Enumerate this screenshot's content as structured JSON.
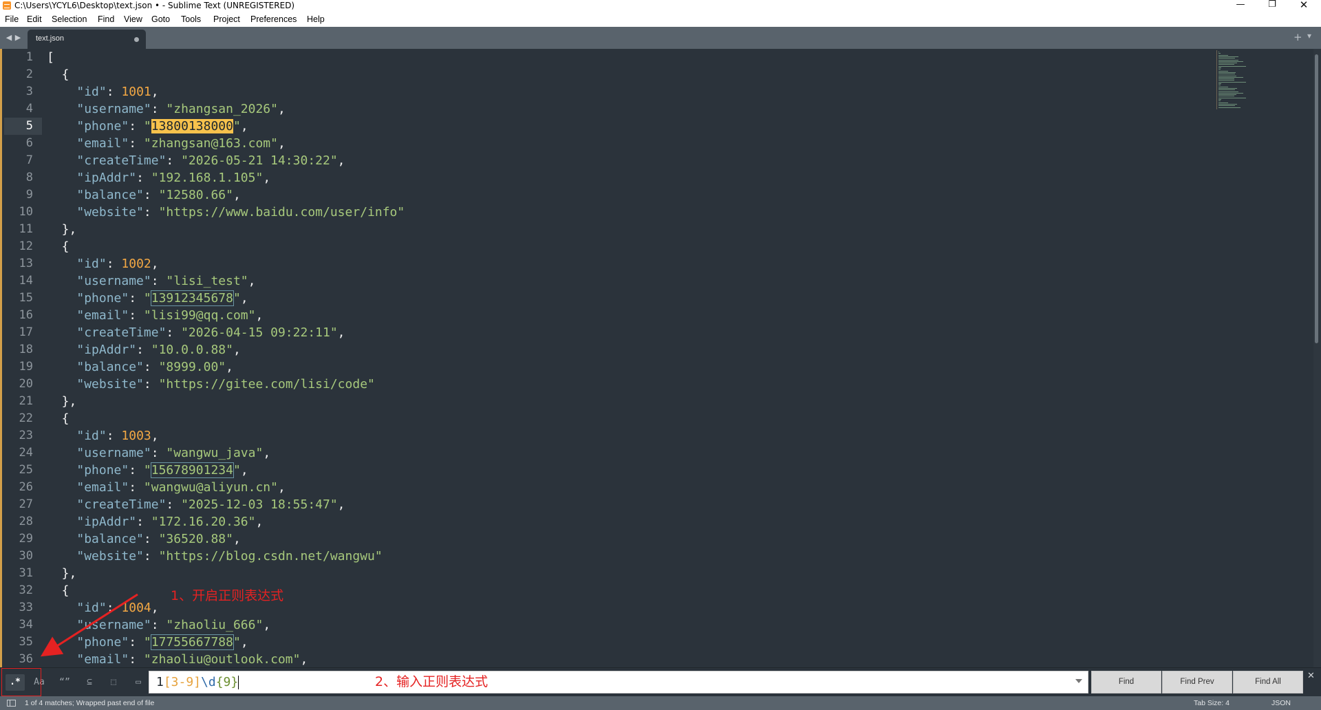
{
  "window": {
    "title": "C:\\Users\\YCYL6\\Desktop\\text.json • - Sublime Text (UNREGISTERED)",
    "minimize": "—",
    "maximize": "❐",
    "close": "✕"
  },
  "menu": [
    "File",
    "Edit",
    "Selection",
    "Find",
    "View",
    "Goto",
    "Tools",
    "Project",
    "Preferences",
    "Help"
  ],
  "tabs": {
    "active_label": "text.json",
    "back_glyph": "◀",
    "forward_glyph": "▶",
    "new_tab_glyph": "+",
    "overflow_glyph": "▾"
  },
  "editor": {
    "current_line": 5,
    "line_numbers": [
      "1",
      "2",
      "3",
      "4",
      "5",
      "6",
      "7",
      "8",
      "9",
      "10",
      "11",
      "12",
      "13",
      "14",
      "15",
      "16",
      "17",
      "18",
      "19",
      "20",
      "21",
      "22",
      "23",
      "24",
      "25",
      "26",
      "27",
      "28",
      "29",
      "30",
      "31",
      "32",
      "33",
      "34",
      "35",
      "36"
    ],
    "lines": [
      [
        {
          "t": "[",
          "c": "punc"
        }
      ],
      [
        {
          "t": "  {",
          "c": "punc"
        }
      ],
      [
        {
          "t": "    ",
          "c": "punc"
        },
        {
          "t": "\"id\"",
          "c": "key"
        },
        {
          "t": ": ",
          "c": "punc"
        },
        {
          "t": "1001",
          "c": "num"
        },
        {
          "t": ",",
          "c": "punc"
        }
      ],
      [
        {
          "t": "    ",
          "c": "punc"
        },
        {
          "t": "\"username\"",
          "c": "key"
        },
        {
          "t": ": ",
          "c": "punc"
        },
        {
          "t": "\"zhangsan_2026\"",
          "c": "str"
        },
        {
          "t": ",",
          "c": "punc"
        }
      ],
      [
        {
          "t": "    ",
          "c": "punc"
        },
        {
          "t": "\"phone\"",
          "c": "key"
        },
        {
          "t": ": ",
          "c": "punc"
        },
        {
          "t": "\"",
          "c": "str"
        },
        {
          "t": "13800138000",
          "c": "match-current"
        },
        {
          "t": "\"",
          "c": "str"
        },
        {
          "t": ",",
          "c": "punc"
        }
      ],
      [
        {
          "t": "    ",
          "c": "punc"
        },
        {
          "t": "\"email\"",
          "c": "key"
        },
        {
          "t": ": ",
          "c": "punc"
        },
        {
          "t": "\"zhangsan@163.com\"",
          "c": "str"
        },
        {
          "t": ",",
          "c": "punc"
        }
      ],
      [
        {
          "t": "    ",
          "c": "punc"
        },
        {
          "t": "\"createTime\"",
          "c": "key"
        },
        {
          "t": ": ",
          "c": "punc"
        },
        {
          "t": "\"2026-05-21 14:30:22\"",
          "c": "str"
        },
        {
          "t": ",",
          "c": "punc"
        }
      ],
      [
        {
          "t": "    ",
          "c": "punc"
        },
        {
          "t": "\"ipAddr\"",
          "c": "key"
        },
        {
          "t": ": ",
          "c": "punc"
        },
        {
          "t": "\"192.168.1.105\"",
          "c": "str"
        },
        {
          "t": ",",
          "c": "punc"
        }
      ],
      [
        {
          "t": "    ",
          "c": "punc"
        },
        {
          "t": "\"balance\"",
          "c": "key"
        },
        {
          "t": ": ",
          "c": "punc"
        },
        {
          "t": "\"12580.66\"",
          "c": "str"
        },
        {
          "t": ",",
          "c": "punc"
        }
      ],
      [
        {
          "t": "    ",
          "c": "punc"
        },
        {
          "t": "\"website\"",
          "c": "key"
        },
        {
          "t": ": ",
          "c": "punc"
        },
        {
          "t": "\"https://www.baidu.com/user/info\"",
          "c": "str"
        }
      ],
      [
        {
          "t": "  },",
          "c": "punc"
        }
      ],
      [
        {
          "t": "  {",
          "c": "punc"
        }
      ],
      [
        {
          "t": "    ",
          "c": "punc"
        },
        {
          "t": "\"id\"",
          "c": "key"
        },
        {
          "t": ": ",
          "c": "punc"
        },
        {
          "t": "1002",
          "c": "num"
        },
        {
          "t": ",",
          "c": "punc"
        }
      ],
      [
        {
          "t": "    ",
          "c": "punc"
        },
        {
          "t": "\"username\"",
          "c": "key"
        },
        {
          "t": ": ",
          "c": "punc"
        },
        {
          "t": "\"lisi_test\"",
          "c": "str"
        },
        {
          "t": ",",
          "c": "punc"
        }
      ],
      [
        {
          "t": "    ",
          "c": "punc"
        },
        {
          "t": "\"phone\"",
          "c": "key"
        },
        {
          "t": ": ",
          "c": "punc"
        },
        {
          "t": "\"",
          "c": "str"
        },
        {
          "t": "13912345678",
          "c": "match"
        },
        {
          "t": "\"",
          "c": "str"
        },
        {
          "t": ",",
          "c": "punc"
        }
      ],
      [
        {
          "t": "    ",
          "c": "punc"
        },
        {
          "t": "\"email\"",
          "c": "key"
        },
        {
          "t": ": ",
          "c": "punc"
        },
        {
          "t": "\"lisi99@qq.com\"",
          "c": "str"
        },
        {
          "t": ",",
          "c": "punc"
        }
      ],
      [
        {
          "t": "    ",
          "c": "punc"
        },
        {
          "t": "\"createTime\"",
          "c": "key"
        },
        {
          "t": ": ",
          "c": "punc"
        },
        {
          "t": "\"2026-04-15 09:22:11\"",
          "c": "str"
        },
        {
          "t": ",",
          "c": "punc"
        }
      ],
      [
        {
          "t": "    ",
          "c": "punc"
        },
        {
          "t": "\"ipAddr\"",
          "c": "key"
        },
        {
          "t": ": ",
          "c": "punc"
        },
        {
          "t": "\"10.0.0.88\"",
          "c": "str"
        },
        {
          "t": ",",
          "c": "punc"
        }
      ],
      [
        {
          "t": "    ",
          "c": "punc"
        },
        {
          "t": "\"balance\"",
          "c": "key"
        },
        {
          "t": ": ",
          "c": "punc"
        },
        {
          "t": "\"8999.00\"",
          "c": "str"
        },
        {
          "t": ",",
          "c": "punc"
        }
      ],
      [
        {
          "t": "    ",
          "c": "punc"
        },
        {
          "t": "\"website\"",
          "c": "key"
        },
        {
          "t": ": ",
          "c": "punc"
        },
        {
          "t": "\"https://gitee.com/lisi/code\"",
          "c": "str"
        }
      ],
      [
        {
          "t": "  },",
          "c": "punc"
        }
      ],
      [
        {
          "t": "  {",
          "c": "punc"
        }
      ],
      [
        {
          "t": "    ",
          "c": "punc"
        },
        {
          "t": "\"id\"",
          "c": "key"
        },
        {
          "t": ": ",
          "c": "punc"
        },
        {
          "t": "1003",
          "c": "num"
        },
        {
          "t": ",",
          "c": "punc"
        }
      ],
      [
        {
          "t": "    ",
          "c": "punc"
        },
        {
          "t": "\"username\"",
          "c": "key"
        },
        {
          "t": ": ",
          "c": "punc"
        },
        {
          "t": "\"wangwu_java\"",
          "c": "str"
        },
        {
          "t": ",",
          "c": "punc"
        }
      ],
      [
        {
          "t": "    ",
          "c": "punc"
        },
        {
          "t": "\"phone\"",
          "c": "key"
        },
        {
          "t": ": ",
          "c": "punc"
        },
        {
          "t": "\"",
          "c": "str"
        },
        {
          "t": "15678901234",
          "c": "match"
        },
        {
          "t": "\"",
          "c": "str"
        },
        {
          "t": ",",
          "c": "punc"
        }
      ],
      [
        {
          "t": "    ",
          "c": "punc"
        },
        {
          "t": "\"email\"",
          "c": "key"
        },
        {
          "t": ": ",
          "c": "punc"
        },
        {
          "t": "\"wangwu@aliyun.cn\"",
          "c": "str"
        },
        {
          "t": ",",
          "c": "punc"
        }
      ],
      [
        {
          "t": "    ",
          "c": "punc"
        },
        {
          "t": "\"createTime\"",
          "c": "key"
        },
        {
          "t": ": ",
          "c": "punc"
        },
        {
          "t": "\"2025-12-03 18:55:47\"",
          "c": "str"
        },
        {
          "t": ",",
          "c": "punc"
        }
      ],
      [
        {
          "t": "    ",
          "c": "punc"
        },
        {
          "t": "\"ipAddr\"",
          "c": "key"
        },
        {
          "t": ": ",
          "c": "punc"
        },
        {
          "t": "\"172.16.20.36\"",
          "c": "str"
        },
        {
          "t": ",",
          "c": "punc"
        }
      ],
      [
        {
          "t": "    ",
          "c": "punc"
        },
        {
          "t": "\"balance\"",
          "c": "key"
        },
        {
          "t": ": ",
          "c": "punc"
        },
        {
          "t": "\"36520.88\"",
          "c": "str"
        },
        {
          "t": ",",
          "c": "punc"
        }
      ],
      [
        {
          "t": "    ",
          "c": "punc"
        },
        {
          "t": "\"website\"",
          "c": "key"
        },
        {
          "t": ": ",
          "c": "punc"
        },
        {
          "t": "\"https://blog.csdn.net/wangwu\"",
          "c": "str"
        }
      ],
      [
        {
          "t": "  },",
          "c": "punc"
        }
      ],
      [
        {
          "t": "  {",
          "c": "punc"
        }
      ],
      [
        {
          "t": "    ",
          "c": "punc"
        },
        {
          "t": "\"id\"",
          "c": "key"
        },
        {
          "t": ": ",
          "c": "punc"
        },
        {
          "t": "1004",
          "c": "num"
        },
        {
          "t": ",",
          "c": "punc"
        }
      ],
      [
        {
          "t": "    ",
          "c": "punc"
        },
        {
          "t": "\"username\"",
          "c": "key"
        },
        {
          "t": ": ",
          "c": "punc"
        },
        {
          "t": "\"zhaoliu_666\"",
          "c": "str"
        },
        {
          "t": ",",
          "c": "punc"
        }
      ],
      [
        {
          "t": "    ",
          "c": "punc"
        },
        {
          "t": "\"phone\"",
          "c": "key"
        },
        {
          "t": ": ",
          "c": "punc"
        },
        {
          "t": "\"",
          "c": "str"
        },
        {
          "t": "17755667788",
          "c": "match"
        },
        {
          "t": "\"",
          "c": "str"
        },
        {
          "t": ",",
          "c": "punc"
        }
      ],
      [
        {
          "t": "    ",
          "c": "punc"
        },
        {
          "t": "\"email\"",
          "c": "key"
        },
        {
          "t": ": ",
          "c": "punc"
        },
        {
          "t": "\"zhaoliu@outlook.com\"",
          "c": "str"
        },
        {
          "t": ",",
          "c": "punc"
        }
      ]
    ]
  },
  "find_panel": {
    "options": {
      "regex": ".*",
      "case": "Aa",
      "whole_word": "“”",
      "wrap": "⊆",
      "in_selection": "⬚",
      "highlight": "▭"
    },
    "query_parts": [
      {
        "t": "1",
        "c": "lit"
      },
      {
        "t": "[3-9]",
        "c": "set"
      },
      {
        "t": "\\d",
        "c": "esc"
      },
      {
        "t": "{9}",
        "c": "quant"
      }
    ],
    "find_label": "Find",
    "find_prev_label": "Find Prev",
    "find_all_label": "Find All",
    "close_glyph": "✕"
  },
  "status": {
    "message": "1 of 4 matches; Wrapped past end of file",
    "tab_size": "Tab Size: 4",
    "syntax": "JSON"
  },
  "annotations": {
    "step1": "1、开启正则表达式",
    "step2": "2、输入正则表达式",
    "color": "#e52222"
  },
  "colors": {
    "editor_bg": "#2b333b",
    "key": "#8fb8cc",
    "string": "#a7c97c",
    "number": "#f3a844",
    "current_match": "#f7c24c"
  }
}
